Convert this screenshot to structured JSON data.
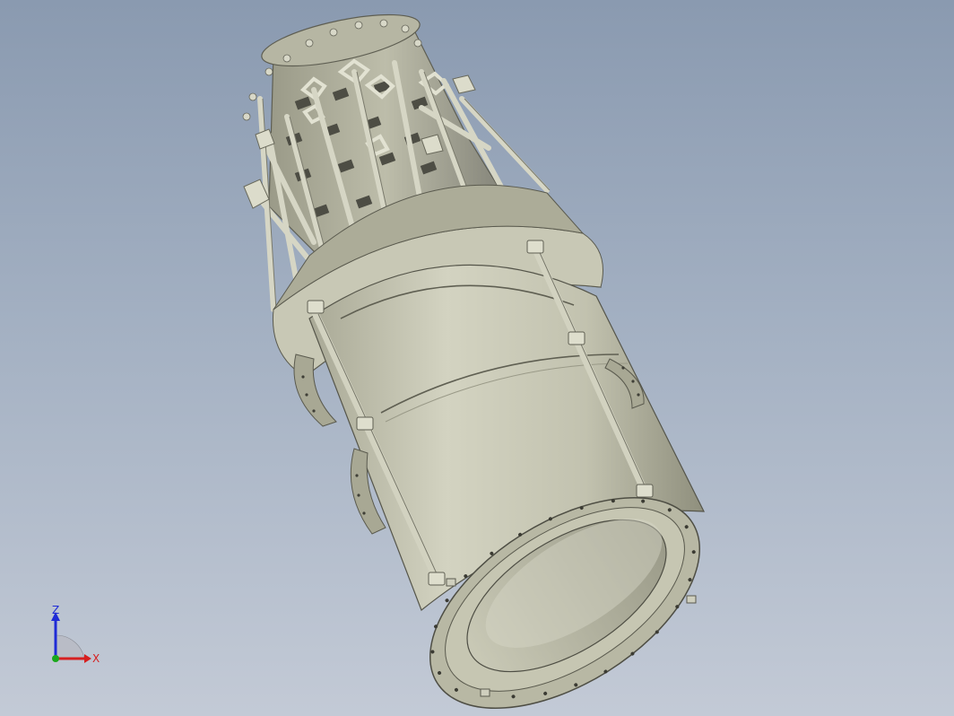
{
  "viewport": {
    "background_top": "#8a9ab0",
    "background_bottom": "#c3cad6",
    "model_color": "#c5c5b2",
    "model_shadow": "#8f8f7e",
    "model_edge": "#555548"
  },
  "triad": {
    "z_label": "Z",
    "x_label": "X",
    "z_color": "#1f2bd6",
    "x_color": "#d61f1f",
    "y_color": "#19a81c"
  }
}
